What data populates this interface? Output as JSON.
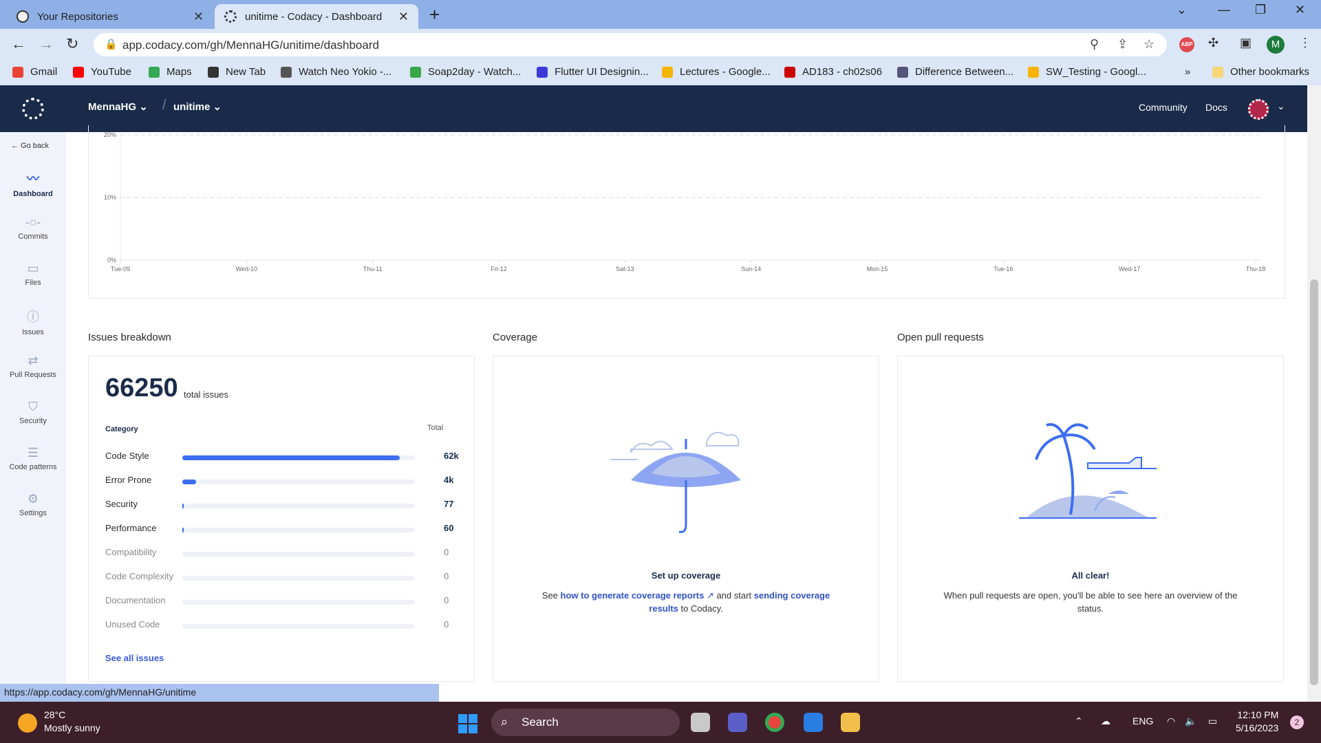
{
  "browser": {
    "tabs": [
      {
        "title": "Your Repositories"
      },
      {
        "title": "unitime - Codacy - Dashboard"
      }
    ],
    "url": "app.codacy.com/gh/MennaHG/unitime/dashboard",
    "bookmarks": [
      {
        "label": "Gmail",
        "color": "#ea4335"
      },
      {
        "label": "YouTube",
        "color": "#ff0000"
      },
      {
        "label": "Maps",
        "color": "#34a853"
      },
      {
        "label": "New Tab",
        "color": "#333333"
      },
      {
        "label": "Watch Neo Yokio -...",
        "color": "#555555"
      },
      {
        "label": "Soap2day - Watch...",
        "color": "#3aa64a"
      },
      {
        "label": "Flutter UI Designin...",
        "color": "#3b3bd9"
      },
      {
        "label": "Lectures - Google...",
        "color": "#f4b400"
      },
      {
        "label": "AD183 - ch02s06",
        "color": "#cc0000"
      },
      {
        "label": "Difference Between...",
        "color": "#555577"
      },
      {
        "label": "SW_Testing - Googl...",
        "color": "#f4b400"
      }
    ],
    "bookmarks_more": "»",
    "other_bookmarks": "Other bookmarks",
    "profile_initial": "M",
    "abp_label": "ABP"
  },
  "app": {
    "org": "MennaHG",
    "repo": "unitime",
    "nav_links": [
      "Community",
      "Docs"
    ]
  },
  "sidebar": {
    "go_back": "Go back",
    "items": [
      {
        "label": "Dashboard",
        "icon": "chart-icon"
      },
      {
        "label": "Commits",
        "icon": "commit-icon"
      },
      {
        "label": "Files",
        "icon": "file-icon"
      },
      {
        "label": "Issues",
        "icon": "issue-icon"
      },
      {
        "label": "Pull Requests",
        "icon": "pull-request-icon"
      },
      {
        "label": "Security",
        "icon": "shield-icon"
      },
      {
        "label": "Code patterns",
        "icon": "list-icon"
      },
      {
        "label": "Settings",
        "icon": "gear-icon"
      }
    ]
  },
  "chart_data": {
    "type": "line",
    "y_ticks": [
      "20%",
      "10%",
      "0%"
    ],
    "ylim": [
      0,
      20
    ],
    "categories": [
      "Tue-09",
      "Wed-10",
      "Thu-11",
      "Fri-12",
      "Sat-13",
      "Sun-14",
      "Mon-15",
      "Tue-16",
      "Wed-17",
      "Thu-18"
    ],
    "series": [],
    "grid": true
  },
  "issues": {
    "section_title": "Issues breakdown",
    "total": "66250",
    "total_label": "total issues",
    "category_header": "Category",
    "total_header": "Total",
    "rows": [
      {
        "name": "Code Style",
        "value": "62k",
        "fraction": 0.935
      },
      {
        "name": "Error Prone",
        "value": "4k",
        "fraction": 0.06
      },
      {
        "name": "Security",
        "value": "77",
        "fraction": 0.003
      },
      {
        "name": "Performance",
        "value": "60",
        "fraction": 0.003
      },
      {
        "name": "Compatibility",
        "value": "0",
        "fraction": 0
      },
      {
        "name": "Code Complexity",
        "value": "0",
        "fraction": 0
      },
      {
        "name": "Documentation",
        "value": "0",
        "fraction": 0
      },
      {
        "name": "Unused Code",
        "value": "0",
        "fraction": 0
      }
    ],
    "see_all": "See all issues"
  },
  "coverage": {
    "section_title": "Coverage",
    "empty_title": "Set up coverage",
    "text_pre": "See ",
    "link1": "how to generate coverage reports",
    "text_mid": " and start ",
    "link2": "sending coverage results",
    "text_post": " to Codacy."
  },
  "pull_requests": {
    "section_title": "Open pull requests",
    "empty_title": "All clear!",
    "empty_text": "When pull requests are open, you'll be able to see here an overview of the status."
  },
  "status_url": "https://app.codacy.com/gh/MennaHG/unitime",
  "taskbar": {
    "temperature": "28°C",
    "weather": "Mostly sunny",
    "search": "Search",
    "lang": "ENG",
    "time": "12:10 PM",
    "date": "5/16/2023",
    "notifications": "2"
  },
  "colors": {
    "accent": "#3b6ef0",
    "header_bg": "#1a2b4a",
    "link": "#2f52c8"
  }
}
